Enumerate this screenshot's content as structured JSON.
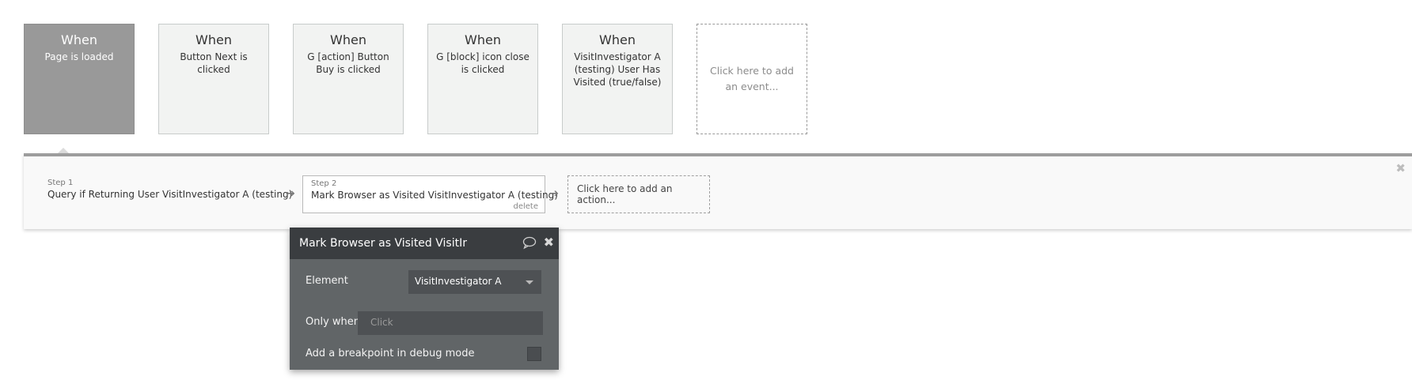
{
  "events": [
    {
      "when": "When",
      "desc": "Page is loaded",
      "active": true
    },
    {
      "when": "When",
      "desc": "Button Next is clicked"
    },
    {
      "when": "When",
      "desc": "G [action] Button Buy is clicked"
    },
    {
      "when": "When",
      "desc": "G [block] icon close is clicked"
    },
    {
      "when": "When",
      "desc": "VisitInvestigator A (testing) User Has Visited (true/false)"
    }
  ],
  "add_event_label": "Click here to add an event...",
  "steps": [
    {
      "num": "Step 1",
      "name": "Query if Returning User VisitInvestigator A (testing)"
    },
    {
      "num": "Step 2",
      "name": "Mark Browser as Visited VisitInvestigator A (testing)",
      "delete_label": "delete"
    }
  ],
  "add_action_label": "Click here to add an action...",
  "panel": {
    "title": "Mark Browser as Visited VisitInvestigator A (testing)",
    "element_label": "Element",
    "element_value": "VisitInvestigator A",
    "only_when_label": "Only when",
    "only_when_placeholder": "Click",
    "breakpoint_label": "Add a breakpoint in debug mode"
  },
  "icons": {
    "close": "close-icon",
    "comment": "comment-icon",
    "arrow": "arrow-right-icon",
    "caret": "chevron-down-icon"
  }
}
